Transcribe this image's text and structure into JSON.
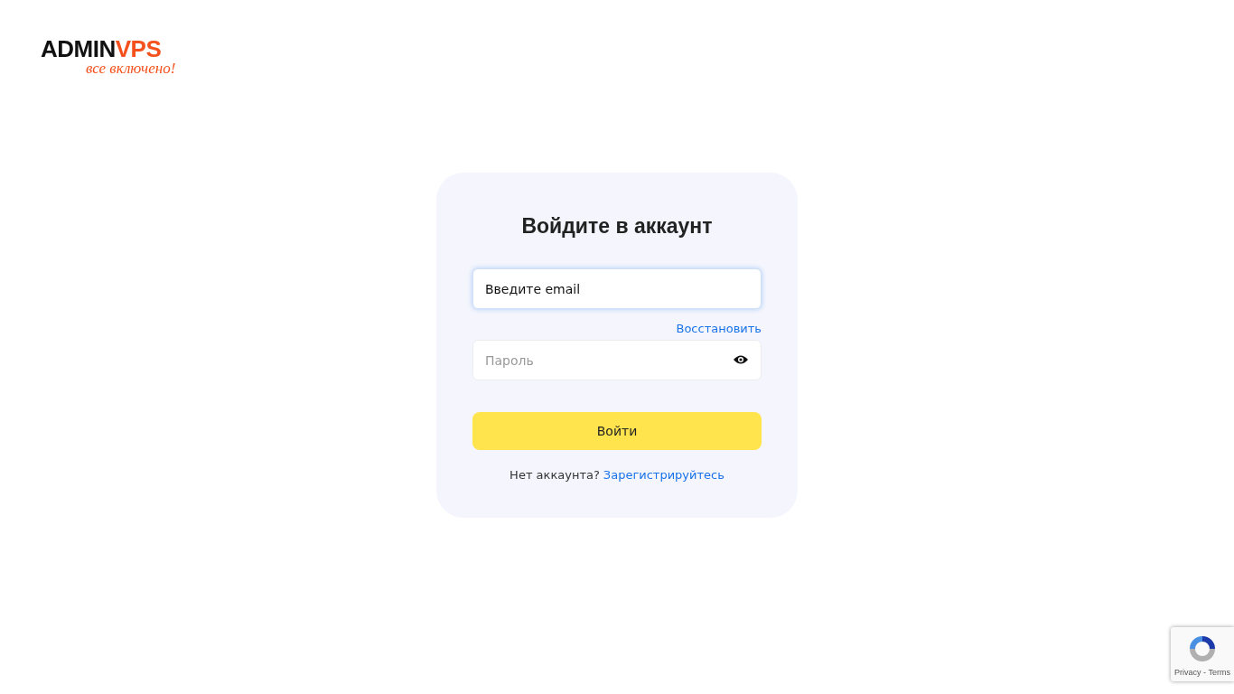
{
  "logo": {
    "brand_dark": "ADMIN",
    "brand_accent": "VPS",
    "tagline": "все включено!"
  },
  "login": {
    "title": "Войдите в аккаунт",
    "email_field": {
      "placeholder": "Введите email",
      "focused": true
    },
    "recover_link": "Восстановить",
    "password_field": {
      "placeholder": "Пароль",
      "focused": false
    },
    "submit": "Войти",
    "signup_prompt": "Нет аккаунта?",
    "signup_link": "Зарегистрируйтесь"
  },
  "recaptcha": {
    "links": "Privacy - Terms"
  }
}
